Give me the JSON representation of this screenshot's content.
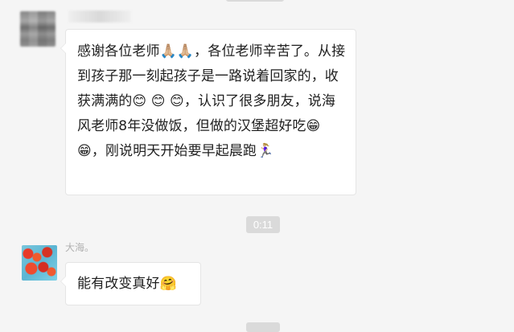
{
  "conversation": {
    "first_message": {
      "text": "感谢各位老师🙏🏼🙏🏼，各位老师辛苦了。从接到孩子那一刻起孩子是一路说着回家的，收获满满的😊 😊 😊，认识了很多朋友，说海风老师8年没做饭，但做的汉堡超好吃😁 😁，刚说明天开始要早起晨跑🏃🏼‍♀️"
    },
    "timestamp_label": "0:11",
    "second_sender": {
      "name": "大海。"
    },
    "second_message": {
      "text": "能有改变真好🤗"
    }
  }
}
